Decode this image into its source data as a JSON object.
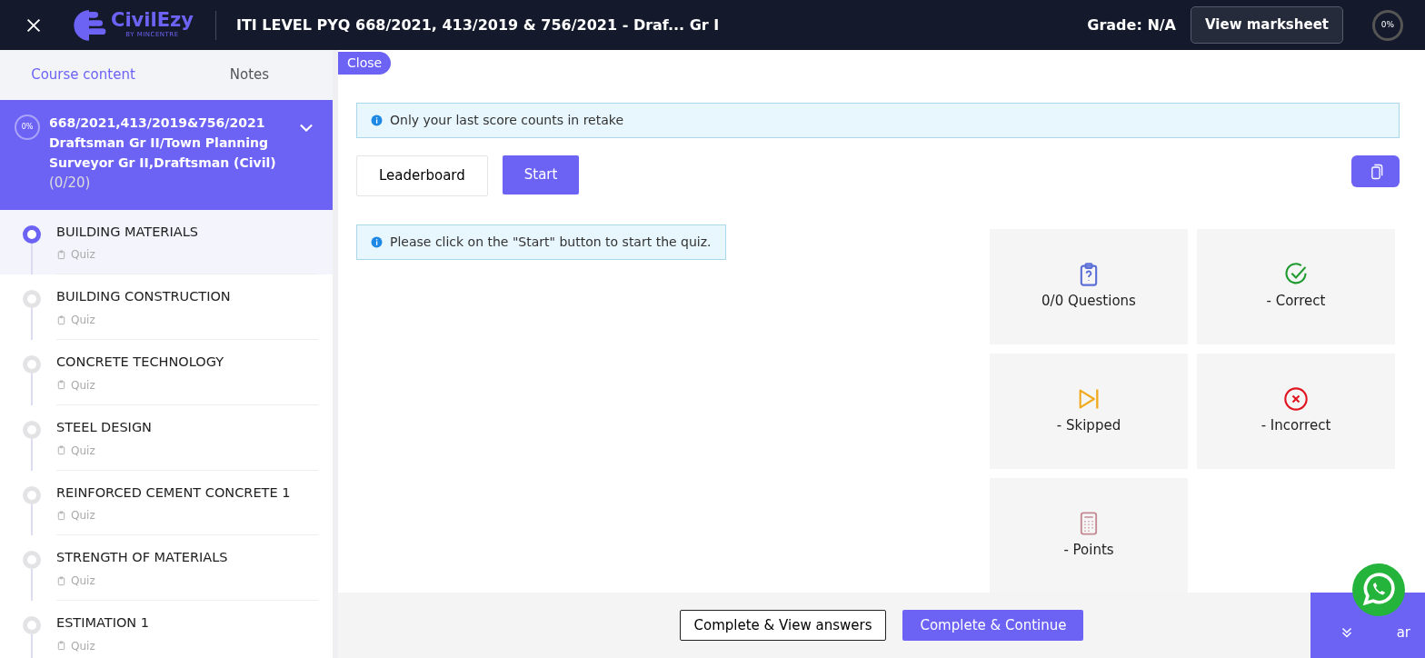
{
  "header": {
    "logo_text": "CivilEzy",
    "logo_tagline": "BY MINCENTRE",
    "title": "ITI LEVEL PYQ 668/2021, 413/2019 & 756/2021 - Draf... Gr I",
    "grade": "Grade: N/A",
    "marksheet_button": "View marksheet",
    "progress": "0%"
  },
  "sidebar": {
    "tabs": [
      {
        "label": "Course content",
        "selected": true
      },
      {
        "label": "Notes",
        "selected": false
      }
    ],
    "section": {
      "progress": "0%",
      "title": "668/2021,413/2019&756/2021 Draftsman Gr II/Town Planning Surveyor Gr II,Draftsman (Civil)",
      "count": "(0/20)",
      "expanded": true
    },
    "items": [
      {
        "title": "BUILDING MATERIALS",
        "type": "Quiz",
        "selected": true
      },
      {
        "title": "BUILDING CONSTRUCTION",
        "type": "Quiz",
        "selected": false
      },
      {
        "title": "CONCRETE TECHNOLOGY",
        "type": "Quiz",
        "selected": false
      },
      {
        "title": "STEEL DESIGN",
        "type": "Quiz",
        "selected": false
      },
      {
        "title": "REINFORCED CEMENT CONCRETE 1",
        "type": "Quiz",
        "selected": false
      },
      {
        "title": "STRENGTH OF MATERIALS",
        "type": "Quiz",
        "selected": false
      },
      {
        "title": "ESTIMATION 1",
        "type": "Quiz",
        "selected": false
      }
    ]
  },
  "main": {
    "close_tab": "Close",
    "retake_notice": "Only your last score counts in retake",
    "buttons": [
      "Leaderboard",
      "Start"
    ],
    "start_notice": "Please click on the \"Start\" button to start the quiz.",
    "stats": [
      {
        "kind": "questions",
        "label": "0/0 Questions"
      },
      {
        "kind": "correct",
        "label": "- Correct"
      },
      {
        "kind": "skipped",
        "label": "- Skipped"
      },
      {
        "kind": "incorrect",
        "label": "- Incorrect"
      },
      {
        "kind": "points",
        "label": "- Points"
      }
    ]
  },
  "footer": {
    "view_answers_button": "Complete & View answers",
    "continue_button": "Complete & Continue",
    "hide_bar": "ar"
  }
}
